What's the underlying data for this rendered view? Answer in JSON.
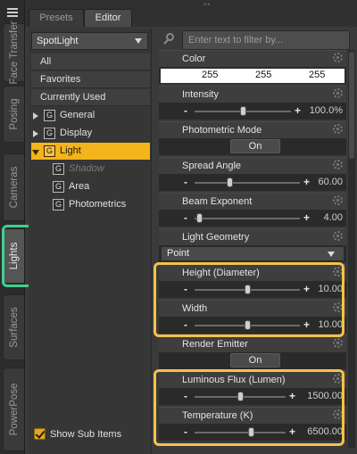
{
  "vertical_tabs": [
    {
      "label": "Face Transfer",
      "active": false
    },
    {
      "label": "Posing",
      "active": false
    },
    {
      "label": "Cameras",
      "active": false
    },
    {
      "label": "Lights",
      "active": true
    },
    {
      "label": "Surfaces",
      "active": false
    },
    {
      "label": "PowerPose",
      "active": false
    }
  ],
  "top_tabs": {
    "presets": "Presets",
    "editor": "Editor",
    "active": "Editor"
  },
  "node_select": {
    "value": "SpotLight"
  },
  "list": {
    "all": "All",
    "favorites": "Favorites",
    "currently_used": "Currently Used",
    "groups": [
      {
        "label": "General",
        "expanded": false
      },
      {
        "label": "Display",
        "expanded": false
      },
      {
        "label": "Light",
        "expanded": true,
        "selected": true
      }
    ],
    "subgroups": [
      "Shadow",
      "Area",
      "Photometrics"
    ],
    "group_icon_letter": "G"
  },
  "show_sub_items": {
    "label": "Show Sub Items",
    "checked": true
  },
  "filter": {
    "placeholder": "Enter text to filter by..."
  },
  "properties": {
    "color": {
      "label": "Color",
      "r": "255",
      "g": "255",
      "b": "255"
    },
    "intensity": {
      "label": "Intensity",
      "value": "100.0%",
      "fraction": 0.5
    },
    "photometric_mode": {
      "label": "Photometric Mode",
      "value": "On"
    },
    "spread_angle": {
      "label": "Spread Angle",
      "value": "60.00",
      "fraction": 0.33
    },
    "beam_exponent": {
      "label": "Beam Exponent",
      "value": "4.00",
      "fraction": 0.04
    },
    "light_geometry": {
      "label": "Light Geometry",
      "value": "Point"
    },
    "height_diameter": {
      "label": "Height (Diameter)",
      "value": "10.00",
      "fraction": 0.5
    },
    "width": {
      "label": "Width",
      "value": "10.00",
      "fraction": 0.5
    },
    "render_emitter": {
      "label": "Render Emitter",
      "value": "On"
    },
    "luminous_flux": {
      "label": "Luminous Flux (Lumen)",
      "value": "1500.00",
      "fraction": 0.5
    },
    "temperature": {
      "label": "Temperature (K)",
      "value": "6500.00",
      "fraction": 0.62
    }
  },
  "symbols": {
    "minus": "-",
    "plus": "+"
  },
  "colors": {
    "accent_selected": "#f3b41c",
    "highlight_yellow": "#f6c14a",
    "highlight_green": "#3fd08f"
  }
}
